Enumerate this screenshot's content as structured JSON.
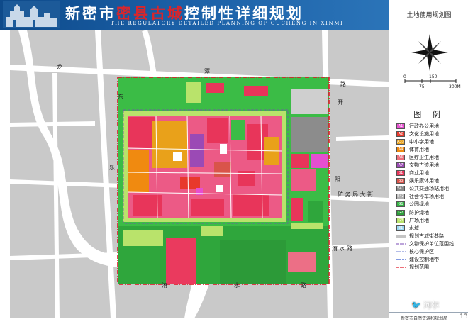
{
  "header": {
    "title_part1": "新密市",
    "title_highlight": "密县古城",
    "title_part2": "控制性详细规划",
    "title_en": "THE REGULATORY DETAILED PLANNING OF GUCHENG IN XINMI"
  },
  "sheet": {
    "title": "土地使用规划图",
    "organization": "新密市自然资源和规划局",
    "page_number": "13",
    "watermark": "🐦 河尔"
  },
  "scale_bar": {
    "unit": "M",
    "labels": [
      "0",
      "75",
      "150",
      "300M"
    ]
  },
  "legend": {
    "title": "图 例",
    "items": [
      {
        "label": "行政办公用地",
        "color": "#e64fd0",
        "code": "A1"
      },
      {
        "label": "文化设施用地",
        "color": "#e8392c",
        "code": "A2"
      },
      {
        "label": "中小学用地",
        "color": "#e9a11a",
        "code": "A33"
      },
      {
        "label": "体育用地",
        "color": "#f08a10",
        "code": "A4"
      },
      {
        "label": "医疗卫生用地",
        "color": "#ec6f7a",
        "code": "A5"
      },
      {
        "label": "文物古迹用地",
        "color": "#9b4ab5",
        "code": "A7"
      },
      {
        "label": "商业用地",
        "color": "#e8355a",
        "code": "B1"
      },
      {
        "label": "娱乐康体用地",
        "color": "#d9544a",
        "code": "B3"
      },
      {
        "label": "公共交通场站用地",
        "color": "#8a8a8a",
        "code": "S41"
      },
      {
        "label": "社会停车场用地",
        "color": "#b0b0b0",
        "code": "S42"
      },
      {
        "label": "公园绿地",
        "color": "#33b444",
        "code": "G1"
      },
      {
        "label": "防护绿地",
        "color": "#2e9e3a",
        "code": "G2"
      },
      {
        "label": "广场用地",
        "color": "#b9e36b",
        "code": "G3"
      },
      {
        "label": "水域",
        "color": "#9cd8f2",
        "code": "E1"
      }
    ],
    "line_items": [
      {
        "label": "规划古城街巷路",
        "style": "double",
        "color": "#8a8a8a"
      },
      {
        "label": "文物保护单位范围线",
        "style": "dash-dot",
        "color": "#7a4ab5"
      },
      {
        "label": "核心保护区",
        "style": "dashed",
        "color": "#9aa6e0"
      },
      {
        "label": "建设控制地带",
        "style": "dashed",
        "color": "#5a7ad8"
      },
      {
        "label": "规划范围",
        "style": "dash-dot",
        "color": "#e01a2a"
      }
    ]
  },
  "roads": [
    {
      "label": "龙",
      "pos": "north-west"
    },
    {
      "label": "潭",
      "pos": "north"
    },
    {
      "label": "路",
      "pos": "north-east"
    },
    {
      "label": "东",
      "pos": "west-upper"
    },
    {
      "label": "乐",
      "pos": "west-middle"
    },
    {
      "label": "开",
      "pos": "east-upper"
    },
    {
      "label": "阳",
      "pos": "east-middle"
    },
    {
      "label": "矿 务 局 大 街",
      "pos": "east-street"
    },
    {
      "label": "洧 水 路",
      "pos": "south-east"
    },
    {
      "label": "洧",
      "pos": "south-west"
    },
    {
      "label": "水",
      "pos": "south-middle"
    },
    {
      "label": "路",
      "pos": "south-east-end"
    }
  ],
  "colors": {
    "banner": "#1a5fa6",
    "title_highlight": "#d8262c",
    "background_map": "#c8c8c8",
    "river": "#ffffff",
    "boundary": "#e01a2a"
  }
}
